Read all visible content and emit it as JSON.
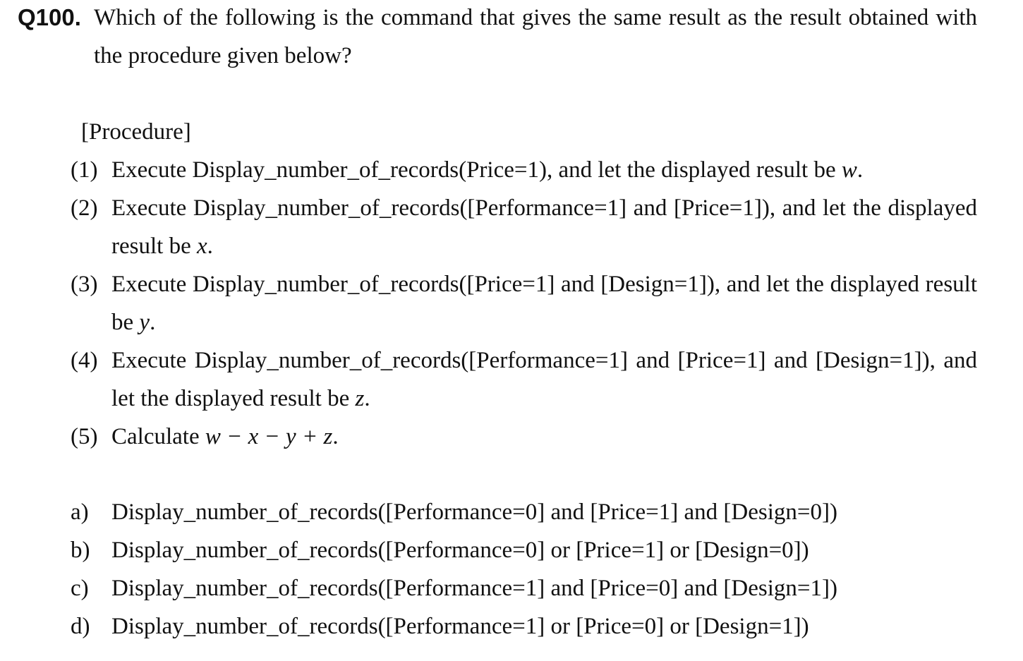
{
  "question": {
    "number": "Q100.",
    "text": "Which of the following is the command that gives the same result as the result obtained with the procedure given below?"
  },
  "procedure": {
    "title": "[Procedure]",
    "steps": [
      {
        "num": "(1)",
        "pre": "Execute Display_number_of_records(Price=1), and let the displayed result be ",
        "var": "w",
        "post": "."
      },
      {
        "num": "(2)",
        "pre": "Execute Display_number_of_records([Performance=1] and [Price=1]), and let the displayed result be ",
        "var": "x",
        "post": "."
      },
      {
        "num": "(3)",
        "pre": "Execute Display_number_of_records([Price=1] and [Design=1]), and let the displayed result be ",
        "var": "y",
        "post": "."
      },
      {
        "num": "(4)",
        "pre": "Execute Display_number_of_records([Performance=1] and [Price=1] and [Design=1]), and let the displayed result be ",
        "var": "z",
        "post": "."
      },
      {
        "num": "(5)",
        "pre": "Calculate ",
        "var": "w − x − y + z",
        "post": "."
      }
    ]
  },
  "choices": [
    {
      "letter": "a)",
      "text": "Display_number_of_records([Performance=0] and [Price=1] and [Design=0])"
    },
    {
      "letter": "b)",
      "text": "Display_number_of_records([Performance=0] or [Price=1] or [Design=0])"
    },
    {
      "letter": "c)",
      "text": "Display_number_of_records([Performance=1] and [Price=0] and [Design=1])"
    },
    {
      "letter": "d)",
      "text": "Display_number_of_records([Performance=1] or [Price=0] or [Design=1])"
    }
  ]
}
